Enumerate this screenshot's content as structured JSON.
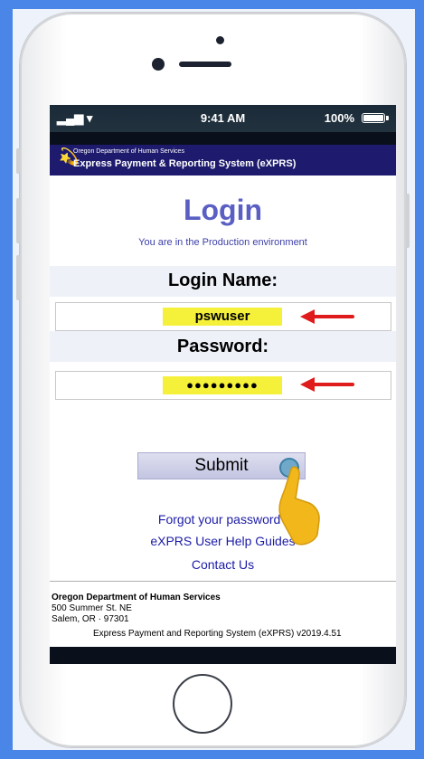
{
  "status_bar": {
    "signal": "▂▄▆ ▾",
    "time": "9:41 AM",
    "battery": "100%"
  },
  "header": {
    "department": "Oregon Department of Human Services",
    "system": "Express Payment & Reporting System (eXPRS)"
  },
  "login": {
    "title": "Login",
    "environment": "You are in the Production environment",
    "login_name_label": "Login Name:",
    "login_name_value": "pswuser",
    "password_label": "Password:",
    "password_value": "●●●●●●●●●",
    "submit_label": "Submit"
  },
  "links": {
    "forgot_password": "Forgot your password?",
    "help_guides": "eXPRS User Help Guides",
    "contact_us": "Contact Us"
  },
  "footer": {
    "department": "Oregon Department of Human Services",
    "address_line1": "500 Summer St. NE",
    "address_line2": "Salem, OR · 97301",
    "version": "Express Payment and Reporting System (eXPRS) v2019.4.51"
  },
  "colors": {
    "header_bg": "#1e1b6e",
    "title": "#5a5fc4",
    "highlight": "#f5f03a",
    "arrow": "#e01b1b",
    "link": "#1b1ba8"
  },
  "icons": [
    "signal-icon",
    "battery-icon",
    "agency-logo-icon",
    "pointing-hand-icon",
    "red-arrow-icon"
  ]
}
